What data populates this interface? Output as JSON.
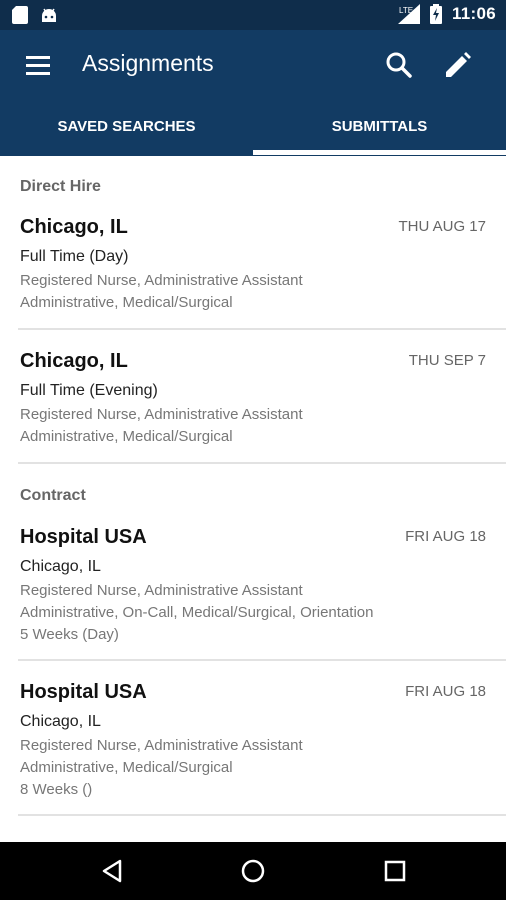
{
  "status_bar": {
    "time": "11:06",
    "network": "LTE"
  },
  "app_bar": {
    "title": "Assignments"
  },
  "tabs": [
    {
      "label": "SAVED SEARCHES"
    },
    {
      "label": "SUBMITTALS"
    }
  ],
  "sections": [
    {
      "header": "Direct Hire",
      "items": [
        {
          "title": "Chicago, IL",
          "date": "THU AUG 17",
          "subtitle": "Full Time (Day)",
          "lines": [
            "Registered Nurse, Administrative Assistant",
            "Administrative, Medical/Surgical"
          ]
        },
        {
          "title": "Chicago, IL",
          "date": "THU SEP 7",
          "subtitle": "Full Time (Evening)",
          "lines": [
            "Registered Nurse, Administrative Assistant",
            "Administrative, Medical/Surgical"
          ]
        }
      ]
    },
    {
      "header": "Contract",
      "items": [
        {
          "title": "Hospital USA",
          "date": "FRI AUG 18",
          "subtitle": "Chicago, IL",
          "lines": [
            "Registered Nurse, Administrative Assistant",
            "Administrative, On-Call, Medical/Surgical, Orientation",
            "5 Weeks (Day)"
          ]
        },
        {
          "title": "Hospital USA",
          "date": "FRI AUG 18",
          "subtitle": "Chicago, IL",
          "lines": [
            "Registered Nurse, Administrative Assistant",
            "Administrative, Medical/Surgical",
            "8 Weeks ()"
          ]
        }
      ]
    }
  ],
  "colors": {
    "app_bar": "#123b63",
    "status_bar": "#0f2d4b",
    "tab_indicator": "#ffffff"
  },
  "icons": {
    "menu": "hamburger-icon",
    "search": "search-icon",
    "edit": "pencil-icon",
    "back": "back-icon",
    "home": "home-icon",
    "recents": "recents-icon"
  }
}
